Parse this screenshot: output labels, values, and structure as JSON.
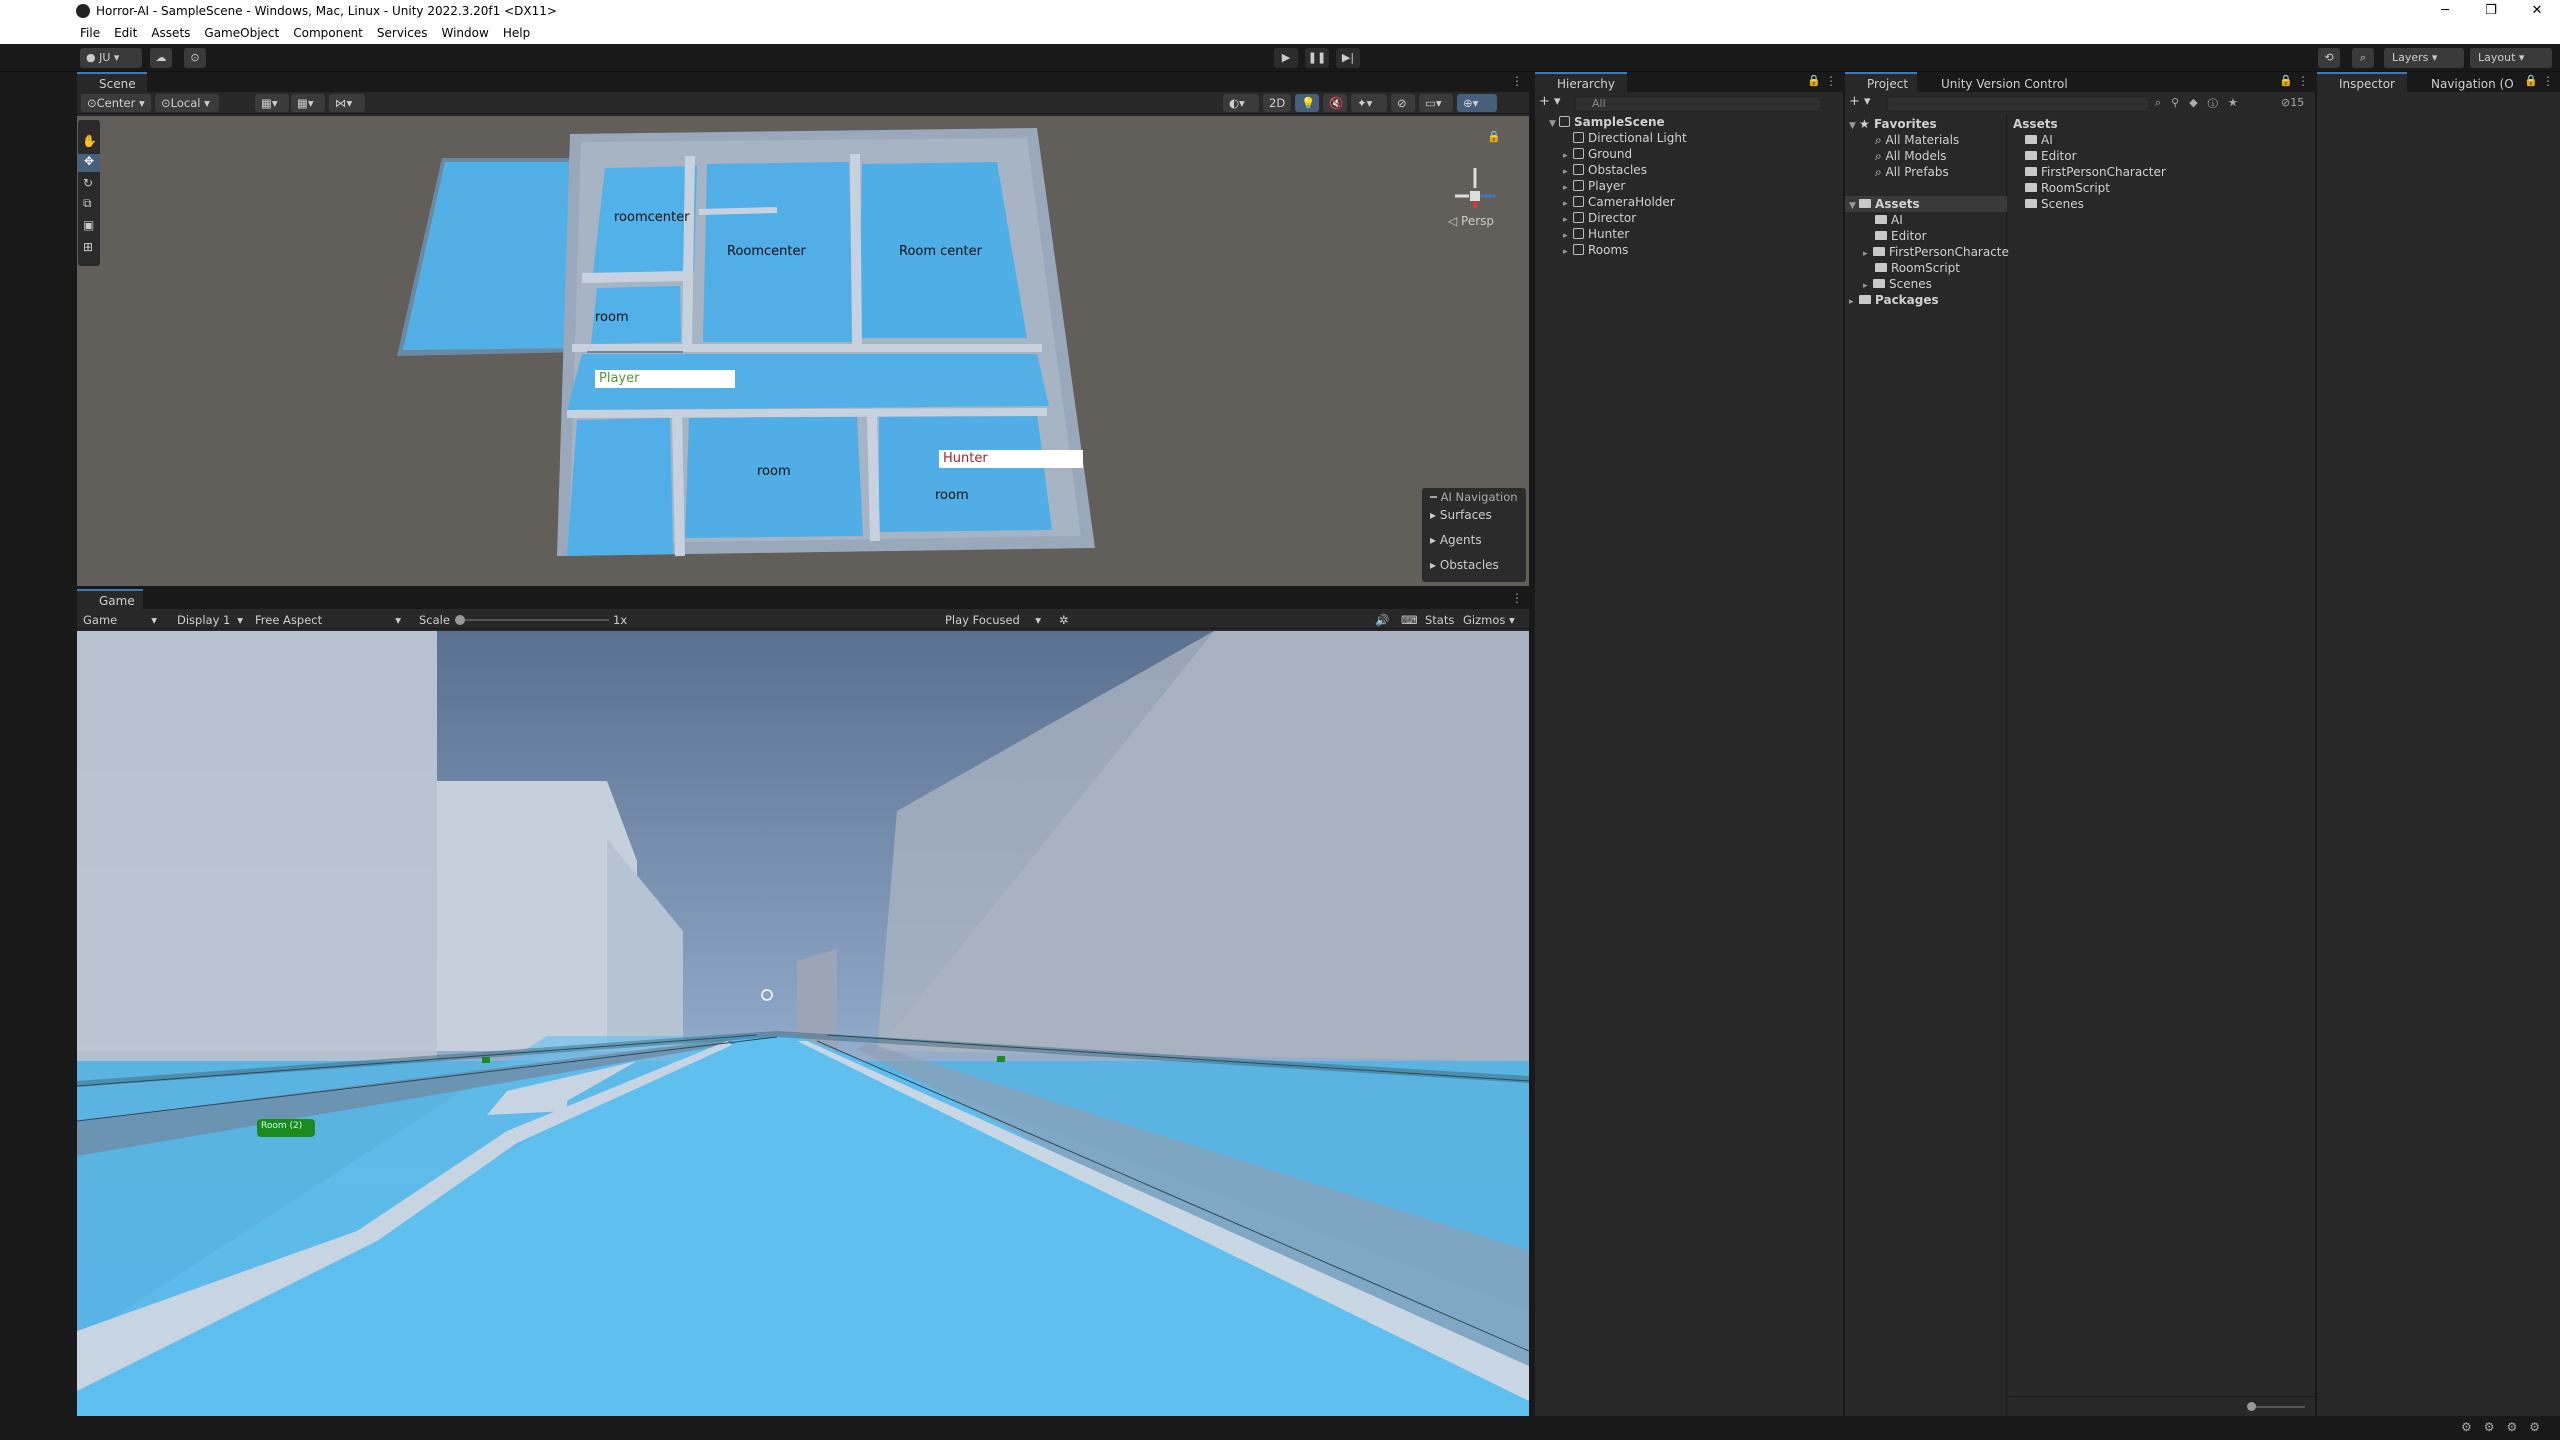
{
  "window": {
    "title": "Horror-AI - SampleScene - Windows, Mac, Linux - Unity 2022.3.20f1 <DX11>",
    "minimize": "─",
    "restore": "❐",
    "close": "✕"
  },
  "menu": [
    "File",
    "Edit",
    "Assets",
    "GameObject",
    "Component",
    "Services",
    "Window",
    "Help"
  ],
  "toolbar": {
    "account": "JU",
    "layers": "Layers",
    "layout": "Layout"
  },
  "scene": {
    "tab": "Scene",
    "pivot": "Center",
    "space": "Local",
    "mode2d": "2D",
    "persp": "Persp",
    "labels": {
      "roomcenter1": "roomcenter",
      "roomcenter2": "Roomcenter",
      "roomcenter3": "Room center",
      "room1": "room",
      "room2": "room",
      "room3": "room",
      "player": "Player",
      "hunter": "Hunter"
    },
    "overlay": {
      "title": "AI Navigation",
      "items": [
        "Surfaces",
        "Agents",
        "Obstacles"
      ]
    }
  },
  "game": {
    "tab": "Game",
    "mode": "Game",
    "display": "Display 1",
    "aspect": "Free Aspect",
    "scale_label": "Scale",
    "scale_value": "1x",
    "play_focused": "Play Focused",
    "stats": "Stats",
    "gizmos": "Gizmos",
    "room_label": "Room (2)"
  },
  "hierarchy": {
    "tab": "Hierarchy",
    "search_placeholder": "All",
    "scene": "SampleScene",
    "items": [
      "Directional Light",
      "Ground",
      "Obstacles",
      "Player",
      "CameraHolder",
      "Director",
      "Hunter",
      "Rooms"
    ]
  },
  "project": {
    "tab": "Project",
    "tab2": "Unity Version Control",
    "badge": "15",
    "favorites": "Favorites",
    "fav_items": [
      "All Materials",
      "All Models",
      "All Prefabs"
    ],
    "assets": "Assets",
    "asset_folders": [
      "AI",
      "Editor",
      "FirstPersonCharacte",
      "RoomScript",
      "Scenes"
    ],
    "packages": "Packages",
    "right_header": "Assets",
    "right_items": [
      "AI",
      "Editor",
      "FirstPersonCharacter",
      "RoomScript",
      "Scenes"
    ]
  },
  "inspector": {
    "tab": "Inspector",
    "tab2": "Navigation (O"
  }
}
